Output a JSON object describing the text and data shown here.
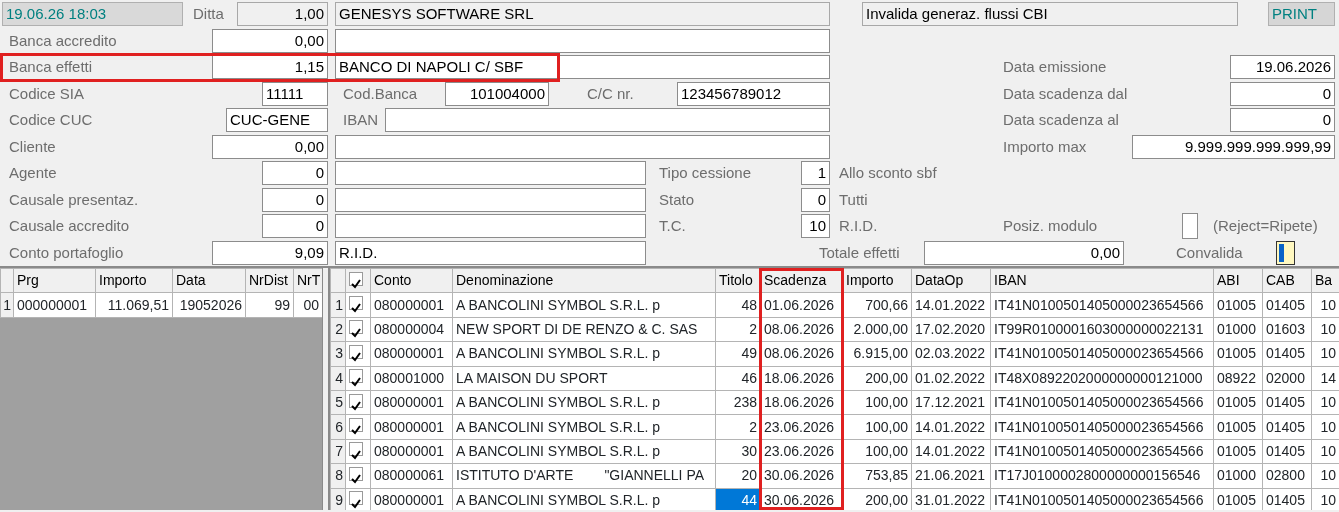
{
  "form_rows": [
    {
      "items": [
        {
          "kind": "clock",
          "text": "19.06.26 18:03"
        },
        {
          "kind": "label",
          "text": "Ditta"
        },
        {
          "kind": "display",
          "value": "1,00"
        },
        {
          "kind": "display",
          "value": "GENESYS SOFTWARE SRL"
        },
        {
          "kind": "display",
          "value": "Invalida generaz. flussi CBI"
        },
        {
          "kind": "button",
          "text": "PRINT"
        }
      ]
    },
    {
      "items": [
        {
          "kind": "label",
          "text": "Banca accredito"
        },
        {
          "kind": "field",
          "value": "0,00"
        },
        {
          "kind": "field"
        }
      ]
    },
    {
      "highlighted": true,
      "items": [
        {
          "kind": "label",
          "text": "Banca effetti"
        },
        {
          "kind": "field",
          "value": "1,15"
        },
        {
          "kind": "field",
          "value": "BANCO DI NAPOLI C/ SBF"
        },
        {
          "kind": "label",
          "text": "Data emissione"
        },
        {
          "kind": "field",
          "value": "19.06.2026"
        }
      ]
    },
    {
      "items": [
        {
          "kind": "label",
          "text": "Codice SIA"
        },
        {
          "kind": "field",
          "value": "11111"
        },
        {
          "kind": "label",
          "text": "Cod.Banca"
        },
        {
          "kind": "field",
          "value": "101004000"
        },
        {
          "kind": "label",
          "text": "C/C nr."
        },
        {
          "kind": "field",
          "value": "123456789012"
        },
        {
          "kind": "label",
          "text": "Data scadenza dal"
        },
        {
          "kind": "field",
          "value": "0"
        }
      ]
    },
    {
      "items": [
        {
          "kind": "label",
          "text": "Codice CUC"
        },
        {
          "kind": "field",
          "value": "CUC-GENE"
        },
        {
          "kind": "label",
          "text": "IBAN"
        },
        {
          "kind": "field"
        },
        {
          "kind": "label",
          "text": "Data scadenza al"
        },
        {
          "kind": "field",
          "value": "0"
        }
      ]
    },
    {
      "items": [
        {
          "kind": "label",
          "text": "Cliente"
        },
        {
          "kind": "field",
          "value": "0,00"
        },
        {
          "kind": "field"
        },
        {
          "kind": "label",
          "text": "Importo max"
        },
        {
          "kind": "field",
          "value": "9.999.999.999.999,99"
        }
      ]
    },
    {
      "items": [
        {
          "kind": "label",
          "text": "Agente"
        },
        {
          "kind": "field",
          "value": "0"
        },
        {
          "kind": "field"
        },
        {
          "kind": "label",
          "text": "Tipo cessione"
        },
        {
          "kind": "field",
          "value": "1"
        },
        {
          "kind": "label",
          "text": "Allo sconto sbf"
        }
      ]
    },
    {
      "items": [
        {
          "kind": "label",
          "text": "Causale presentaz."
        },
        {
          "kind": "field",
          "value": "0"
        },
        {
          "kind": "field"
        },
        {
          "kind": "label",
          "text": "Stato"
        },
        {
          "kind": "field",
          "value": "0"
        },
        {
          "kind": "label",
          "text": "Tutti"
        }
      ]
    },
    {
      "items": [
        {
          "kind": "label",
          "text": "Causale accredito"
        },
        {
          "kind": "field",
          "value": "0"
        },
        {
          "kind": "field"
        },
        {
          "kind": "label",
          "text": "T.C."
        },
        {
          "kind": "field",
          "value": "10"
        },
        {
          "kind": "label",
          "text": "R.I.D."
        },
        {
          "kind": "label",
          "text": "Posiz. modulo"
        },
        {
          "kind": "checkbox",
          "checked": false
        },
        {
          "kind": "label",
          "text": "(Reject=Ripete)"
        }
      ]
    },
    {
      "items": [
        {
          "kind": "label",
          "text": "Conto portafoglio"
        },
        {
          "kind": "field",
          "value": "9,09"
        },
        {
          "kind": "field",
          "value": "R.I.D."
        },
        {
          "kind": "label",
          "text": "Totale effetti"
        },
        {
          "kind": "field",
          "value": "0,00"
        },
        {
          "kind": "label",
          "text": "Convalida"
        },
        {
          "kind": "toggle",
          "on": true
        }
      ]
    }
  ],
  "distinte_table": {
    "columns": [
      {
        "label": "Prg"
      },
      {
        "label": "Importo"
      },
      {
        "label": "Data"
      },
      {
        "label": "NrDist"
      },
      {
        "label": "NrT"
      }
    ],
    "rows": [
      {
        "number": "1",
        "cells": [
          "000000001",
          "11.069,51",
          "19052026",
          "99",
          "00"
        ]
      }
    ]
  },
  "effetti_table": {
    "all_checked": true,
    "columns": [
      {
        "label": "Conto",
        "highlighted": false
      },
      {
        "label": "Denominazione",
        "highlighted": false
      },
      {
        "label": "Titolo",
        "highlighted": false
      },
      {
        "label": "Scadenza",
        "highlighted": true
      },
      {
        "label": "Importo",
        "highlighted": false
      },
      {
        "label": "DataOp",
        "highlighted": false
      },
      {
        "label": "IBAN",
        "highlighted": false
      },
      {
        "label": "ABI",
        "highlighted": false
      },
      {
        "label": "CAB",
        "highlighted": false
      },
      {
        "label": "Ba",
        "highlighted": false
      }
    ],
    "rows": [
      {
        "number": "1",
        "checked": true,
        "selected": false,
        "cells": [
          "080000001",
          "A BANCOLINI SYMBOL S.R.L. p",
          "48",
          "01.06.2026",
          "700,66",
          "14.01.2022",
          "IT41N0100501405000023654566",
          "01005",
          "01405",
          "10"
        ]
      },
      {
        "number": "2",
        "checked": true,
        "selected": false,
        "cells": [
          "080000004",
          "NEW SPORT DI DE RENZO & C. SAS",
          "2",
          "08.06.2026",
          "2.000,00",
          "17.02.2020",
          "IT99R0100001603000000022131",
          "01000",
          "01603",
          "10"
        ]
      },
      {
        "number": "3",
        "checked": true,
        "selected": false,
        "cells": [
          "080000001",
          "A BANCOLINI SYMBOL S.R.L. p",
          "49",
          "08.06.2026",
          "6.915,00",
          "02.03.2022",
          "IT41N0100501405000023654566",
          "01005",
          "01405",
          "10"
        ]
      },
      {
        "number": "4",
        "checked": true,
        "selected": false,
        "cells": [
          "080001000",
          "LA MAISON DU SPORT",
          "46",
          "18.06.2026",
          "200,00",
          "01.02.2022",
          "IT48X0892202000000000121000",
          "08922",
          "02000",
          "14"
        ]
      },
      {
        "number": "5",
        "checked": true,
        "selected": false,
        "cells": [
          "080000001",
          "A BANCOLINI SYMBOL S.R.L. p",
          "238",
          "18.06.2026",
          "100,00",
          "17.12.2021",
          "IT41N0100501405000023654566",
          "01005",
          "01405",
          "10"
        ]
      },
      {
        "number": "6",
        "checked": true,
        "selected": false,
        "cells": [
          "080000001",
          "A BANCOLINI SYMBOL S.R.L. p",
          "2",
          "23.06.2026",
          "100,00",
          "14.01.2022",
          "IT41N0100501405000023654566",
          "01005",
          "01405",
          "10"
        ]
      },
      {
        "number": "7",
        "checked": true,
        "selected": false,
        "cells": [
          "080000001",
          "A BANCOLINI SYMBOL S.R.L. p",
          "30",
          "23.06.2026",
          "100,00",
          "14.01.2022",
          "IT41N0100501405000023654566",
          "01005",
          "01405",
          "10"
        ]
      },
      {
        "number": "8",
        "checked": true,
        "selected": false,
        "cells": [
          "080000061",
          "ISTITUTO D'ARTE        \"GIANNELLI PA",
          "20",
          "30.06.2026",
          "753,85",
          "21.06.2021",
          "IT17J0100002800000000156546",
          "01000",
          "02800",
          "10"
        ]
      },
      {
        "number": "9",
        "checked": true,
        "selected": true,
        "cells": [
          "080000001",
          "A BANCOLINI SYMBOL S.R.L. p",
          "44",
          "30.06.2026",
          "200,00",
          "31.01.2022",
          "IT41N0100501405000023654566",
          "01005",
          "01405",
          "10"
        ]
      }
    ]
  }
}
